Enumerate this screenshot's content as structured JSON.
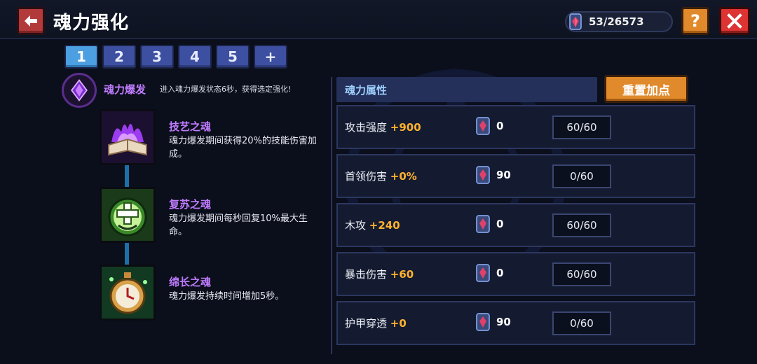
{
  "header": {
    "title": "魂力强化",
    "currency": "53/26573",
    "help_label": "?"
  },
  "tabs": [
    {
      "label": "1"
    },
    {
      "label": "2"
    },
    {
      "label": "3"
    },
    {
      "label": "4"
    },
    {
      "label": "5"
    },
    {
      "label": "+"
    }
  ],
  "burst": {
    "title": "魂力爆发",
    "desc": "进入魂力爆发状态6秒，获得选定强化!"
  },
  "skills": [
    {
      "name": "技艺之魂",
      "desc": "魂力爆发期间获得20%的技能伤害加成。",
      "icon": "purple-flame-book-icon"
    },
    {
      "name": "复苏之魂",
      "desc": "魂力爆发期间每秒回复10%最大生命。",
      "icon": "green-heal-cross-icon"
    },
    {
      "name": "绵长之魂",
      "desc": "魂力爆发持续时间增加5秒。",
      "icon": "stopwatch-icon"
    }
  ],
  "attributes": {
    "header": "魂力属性",
    "reset_label": "重置加点",
    "rows": [
      {
        "name": "攻击强度",
        "bonus": "+900",
        "cost": "0",
        "level": "60/60"
      },
      {
        "name": "首领伤害",
        "bonus": "+0%",
        "cost": "90",
        "level": "0/60"
      },
      {
        "name": "木攻",
        "bonus": "+240",
        "cost": "0",
        "level": "60/60"
      },
      {
        "name": "暴击伤害",
        "bonus": "+60",
        "cost": "0",
        "level": "60/60"
      },
      {
        "name": "护甲穿透",
        "bonus": "+0",
        "cost": "90",
        "level": "0/60"
      }
    ]
  },
  "colors": {
    "accent_orange": "#e08a2c",
    "skill_name_purple": "#c07cff",
    "bonus_yellow": "#ffb22e",
    "tab_active": "#4c9fe0"
  }
}
